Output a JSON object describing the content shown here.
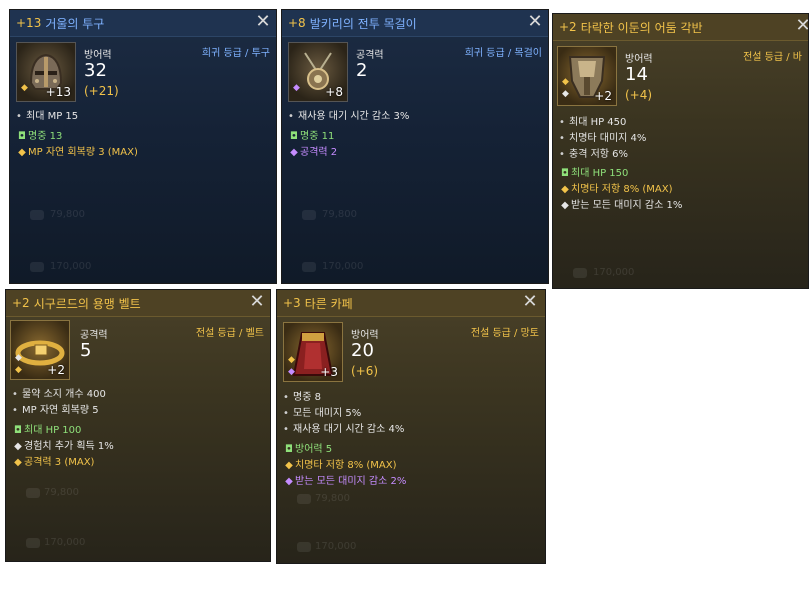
{
  "cards": [
    {
      "enhance": "+13",
      "name": "거울의 투구",
      "stat_label": "방어력",
      "stat_value": "32",
      "stat_bonus": "(+21)",
      "grade": "희귀 등급 / 투구",
      "icon_enh": "+13",
      "stats": [
        {
          "text": "최대 MP 15"
        }
      ],
      "options": [
        {
          "sym": "◘",
          "color": "g",
          "text": "명중 13"
        },
        {
          "sym": "◆",
          "color": "y",
          "text": "MP 자연 회복량 3 (MAX)"
        }
      ],
      "watermarks": [
        "79,800",
        "170,000"
      ]
    },
    {
      "enhance": "+8",
      "name": "발키리의 전투 목걸이",
      "stat_label": "공격력",
      "stat_value": "2",
      "stat_bonus": "",
      "grade": "희귀 등급 / 목걸이",
      "icon_enh": "+8",
      "stats": [
        {
          "text": "재사용 대기 시간 감소 3%"
        }
      ],
      "options": [
        {
          "sym": "◘",
          "color": "g",
          "text": "명중 11"
        },
        {
          "sym": "◆",
          "color": "p",
          "text": "공격력 2"
        }
      ],
      "watermarks": [
        "79,800",
        "170,000"
      ]
    },
    {
      "enhance": "+2",
      "name": "타락한 이둔의 어둠 각반",
      "stat_label": "방어력",
      "stat_value": "14",
      "stat_bonus": "(+4)",
      "grade": "전설 등급 / 바",
      "icon_enh": "+2",
      "stats": [
        {
          "text": "최대 HP 450"
        },
        {
          "text": "치명타 대미지 4%"
        },
        {
          "text": "충격 저항 6%"
        }
      ],
      "options": [
        {
          "sym": "◘",
          "color": "g",
          "text": "최대 HP 150"
        },
        {
          "sym": "◆",
          "color": "y",
          "text": "치명타 저항 8% (MAX)"
        },
        {
          "sym": "◆",
          "color": "w",
          "text": "받는 모든 대미지 감소 1%"
        }
      ],
      "watermarks": [
        "170,000"
      ]
    },
    {
      "enhance": "+2",
      "name": "시구르드의 용맹 벨트",
      "stat_label": "공격력",
      "stat_value": "5",
      "stat_bonus": "",
      "grade": "전설 등급 / 벨트",
      "icon_enh": "+2",
      "stats": [
        {
          "text": "물약 소지 개수 400"
        },
        {
          "text": "MP 자연 회복량 5"
        }
      ],
      "options": [
        {
          "sym": "◘",
          "color": "g",
          "text": "최대 HP 100"
        },
        {
          "sym": "◆",
          "color": "w",
          "text": "경험치 추가 획득 1%"
        },
        {
          "sym": "◆",
          "color": "y",
          "text": "공격력 3 (MAX)"
        }
      ],
      "watermarks": [
        "79,800",
        "170,000"
      ]
    },
    {
      "enhance": "+3",
      "name": "타른 카페",
      "stat_label": "방어력",
      "stat_value": "20",
      "stat_bonus": "(+6)",
      "grade": "전설 등급 / 망토",
      "icon_enh": "+3",
      "stats": [
        {
          "text": "명중 8"
        },
        {
          "text": "모든 대미지 5%"
        },
        {
          "text": "재사용 대기 시간 감소 4%"
        }
      ],
      "options": [
        {
          "sym": "◘",
          "color": "g",
          "text": "방어력 5"
        },
        {
          "sym": "◆",
          "color": "y",
          "text": "치명타 저항 8% (MAX)"
        },
        {
          "sym": "◆",
          "color": "p",
          "text": "받는 모든 대미지 감소 2%"
        }
      ],
      "watermarks": [
        "79,800",
        "170,000"
      ]
    }
  ],
  "close_glyph": "✕"
}
